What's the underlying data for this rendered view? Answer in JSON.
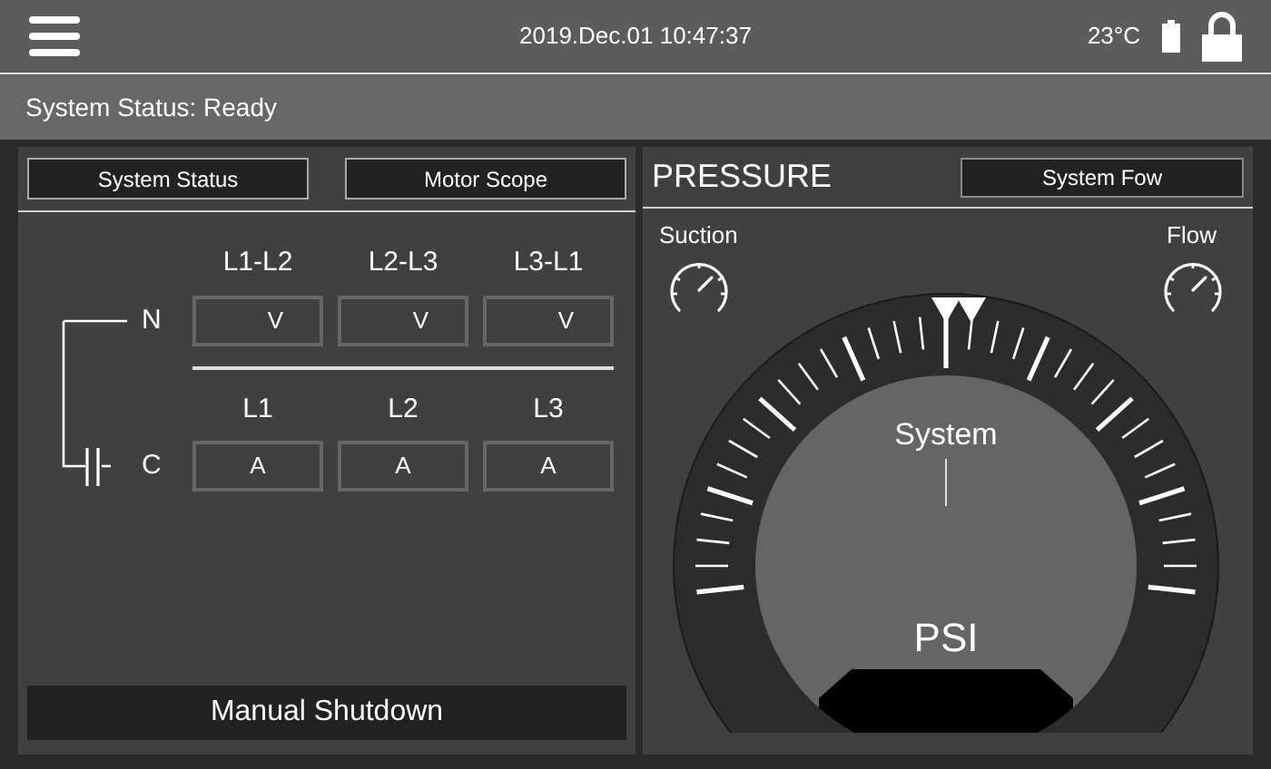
{
  "header": {
    "datetime": "2019.Dec.01 10:47:37",
    "temperature": "23°C"
  },
  "status_bar": {
    "text": "System Status: Ready"
  },
  "left_panel": {
    "tabs": [
      "System Status",
      "Motor Scope"
    ],
    "voltage_columns": [
      "L1-L2",
      "L2-L3",
      "L3-L1"
    ],
    "n_label": "N",
    "voltage_cells": [
      "V",
      "V",
      "V"
    ],
    "current_columns": [
      "L1",
      "L2",
      "L3"
    ],
    "c_label": "C",
    "current_cells": [
      "A",
      "A",
      "A"
    ],
    "shutdown_button": "Manual Shutdown"
  },
  "right_panel": {
    "title": "PRESSURE",
    "flow_button": "System Fow",
    "suction_label": "Suction",
    "flow_label": "Flow",
    "gauge_label": "System",
    "gauge_unit": "PSI"
  }
}
